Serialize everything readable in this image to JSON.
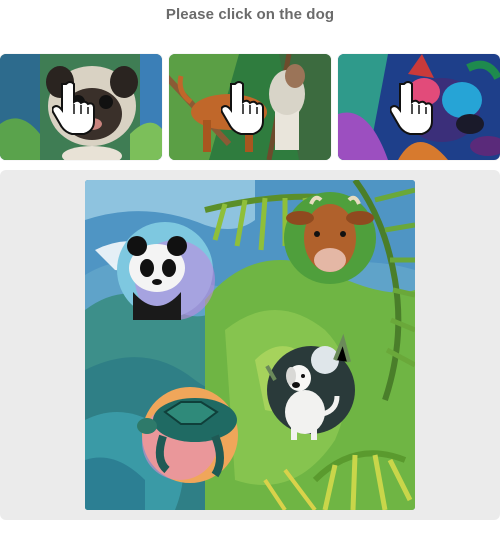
{
  "prompt": {
    "text": "Please click on the dog"
  },
  "examples": [
    {
      "subject": "pug-dog",
      "icon": "pointer-hand-icon"
    },
    {
      "subject": "brown-dog",
      "icon": "pointer-hand-icon"
    },
    {
      "subject": "colorful-dog",
      "icon": "pointer-hand-icon"
    }
  ],
  "challenge": {
    "animals": [
      "panda",
      "cow",
      "turtle",
      "dog"
    ],
    "target": "dog"
  },
  "colors": {
    "panel_background": "#ebebeb",
    "prompt_text": "#6b6b6b",
    "accent": "#2aa6a0"
  }
}
